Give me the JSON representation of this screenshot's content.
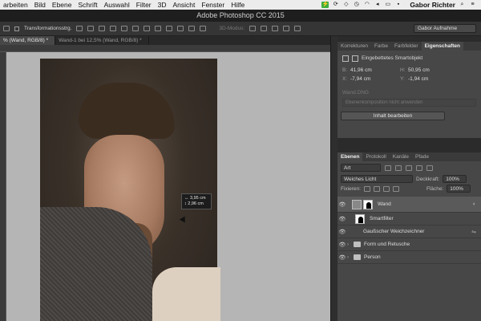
{
  "menubar": {
    "items": [
      "arbeiten",
      "Bild",
      "Ebene",
      "Schrift",
      "Auswahl",
      "Filter",
      "3D",
      "Ansicht",
      "Fenster",
      "Hilfe"
    ],
    "user": "Gabor Richter"
  },
  "titlebar": {
    "title": "Adobe Photoshop CC 2015"
  },
  "options_bar": {
    "transform_label": "Transformationsstrg.",
    "mode_3d": "3D-Modus:",
    "workspace": "Gabor Aufnahme"
  },
  "tabs": [
    {
      "label": "% (Wand, RGB/8) *"
    },
    {
      "label": "Wand-1 bei 12,5% (Wand, RGB/8) *"
    }
  ],
  "canvas": {
    "tooltip_width": "↔ 3,95 cm",
    "tooltip_height": "↕ 2,96 cm"
  },
  "properties": {
    "tabs": [
      "Korrekturen",
      "Farbe",
      "Farbfelder",
      "Eigenschaften"
    ],
    "type_label": "Eingebettetes Smartobjekt",
    "b_label": "B:",
    "b_value": "41,96 cm",
    "h_label": "H:",
    "h_value": "50,95 cm",
    "x_label": "X:",
    "x_value": "-7,94 cm",
    "y_label": "Y:",
    "y_value": "-1,94 cm",
    "source": "Wand.DNG",
    "comp_placeholder": "Ebenenkomposition nicht anwenden",
    "edit_button": "Inhalt bearbeiten"
  },
  "layers_panel": {
    "tabs": [
      "Ebenen",
      "Protokoll",
      "Kanäle",
      "Pfade"
    ],
    "filter_kind": "Art",
    "blend_mode": "Weiches Licht",
    "opacity_label": "Deckkraft:",
    "opacity_value": "100%",
    "lock_label": "Fixieren:",
    "fill_label": "Fläche:",
    "fill_value": "100%",
    "layers": [
      {
        "name": "Wand"
      },
      {
        "name": "Smartfilter"
      },
      {
        "name": "Gaußscher Weichzeichner"
      },
      {
        "name": "Form und Retusche"
      },
      {
        "name": "Person"
      }
    ]
  }
}
